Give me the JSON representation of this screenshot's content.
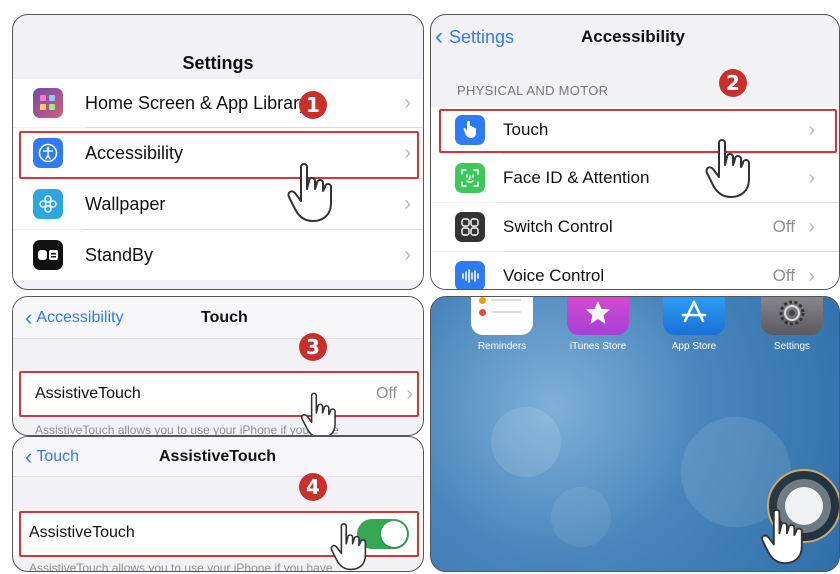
{
  "panel1": {
    "title": "Settings",
    "rows": [
      {
        "label": "Home Screen & App Library",
        "icon": "home-screen-icon"
      },
      {
        "label": "Accessibility",
        "icon": "accessibility-icon"
      },
      {
        "label": "Wallpaper",
        "icon": "wallpaper-icon"
      },
      {
        "label": "StandBy",
        "icon": "standby-icon"
      }
    ],
    "step": "1"
  },
  "panel2": {
    "back_label": "Settings",
    "title": "Accessibility",
    "section_header": "PHYSICAL AND MOTOR",
    "rows": [
      {
        "label": "Touch",
        "value": "",
        "icon": "touch-hand-icon"
      },
      {
        "label": "Face ID & Attention",
        "value": "",
        "icon": "face-id-icon"
      },
      {
        "label": "Switch Control",
        "value": "Off",
        "icon": "switch-control-icon"
      },
      {
        "label": "Voice Control",
        "value": "Off",
        "icon": "voice-control-icon"
      }
    ],
    "step": "2"
  },
  "panel3": {
    "back_label": "Accessibility",
    "title": "Touch",
    "row_label": "AssistiveTouch",
    "row_value": "Off",
    "footer_partial": "AssistiveTouch allows you to use your iPhone if you have",
    "step": "3"
  },
  "panel4": {
    "back_label": "Touch",
    "title": "AssistiveTouch",
    "row_label": "AssistiveTouch",
    "toggle_on": true,
    "footer_partial": "AssistiveTouch allows you to use your iPhone if you have",
    "step": "4"
  },
  "panel5": {
    "apps": [
      {
        "label": "Reminders",
        "icon": "reminders-icon"
      },
      {
        "label": "iTunes Store",
        "icon": "itunes-store-icon"
      },
      {
        "label": "App Store",
        "icon": "app-store-icon"
      },
      {
        "label": "Settings",
        "icon": "settings-gear-icon"
      }
    ]
  },
  "colors": {
    "accent_blue": "#3478f6",
    "highlight_red": "#d0383c",
    "toggle_green": "#34a853",
    "badge_red": "#c9302c"
  }
}
